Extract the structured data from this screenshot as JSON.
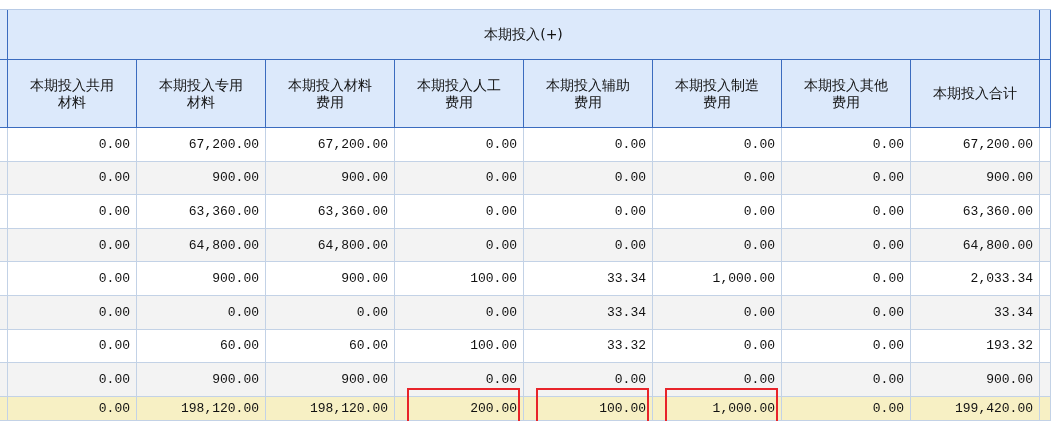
{
  "table": {
    "group_header": "本期投入(+)",
    "columns": [
      "本期投入共用材料",
      "本期投入专用材料",
      "本期投入材料费用",
      "本期投入人工费用",
      "本期投入辅助费用",
      "本期投入制造费用",
      "本期投入其他费用",
      "本期投入合计"
    ],
    "rows": [
      {
        "cells": [
          "0.00",
          "67,200.00",
          "67,200.00",
          "0.00",
          "0.00",
          "0.00",
          "0.00",
          "67,200.00"
        ]
      },
      {
        "cells": [
          "0.00",
          "900.00",
          "900.00",
          "0.00",
          "0.00",
          "0.00",
          "0.00",
          "900.00"
        ]
      },
      {
        "cells": [
          "0.00",
          "63,360.00",
          "63,360.00",
          "0.00",
          "0.00",
          "0.00",
          "0.00",
          "63,360.00"
        ]
      },
      {
        "cells": [
          "0.00",
          "64,800.00",
          "64,800.00",
          "0.00",
          "0.00",
          "0.00",
          "0.00",
          "64,800.00"
        ]
      },
      {
        "cells": [
          "0.00",
          "900.00",
          "900.00",
          "100.00",
          "33.34",
          "1,000.00",
          "0.00",
          "2,033.34"
        ]
      },
      {
        "cells": [
          "0.00",
          "0.00",
          "0.00",
          "0.00",
          "33.34",
          "0.00",
          "0.00",
          "33.34"
        ]
      },
      {
        "cells": [
          "0.00",
          "60.00",
          "60.00",
          "100.00",
          "33.32",
          "0.00",
          "0.00",
          "193.32"
        ]
      },
      {
        "cells": [
          "0.00",
          "900.00",
          "900.00",
          "0.00",
          "0.00",
          "0.00",
          "0.00",
          "900.00"
        ]
      }
    ],
    "total_row": {
      "cells": [
        {
          "text": "0.00",
          "highlighted": false
        },
        {
          "text": "198,120.00",
          "highlighted": false
        },
        {
          "text": "198,120.00",
          "highlighted": false
        },
        {
          "text": "200.00",
          "highlighted": true
        },
        {
          "text": "100.00",
          "highlighted": true
        },
        {
          "text": "1,000.00",
          "highlighted": true
        },
        {
          "text": "0.00",
          "highlighted": false
        },
        {
          "text": "199,420.00",
          "highlighted": false
        }
      ]
    }
  }
}
